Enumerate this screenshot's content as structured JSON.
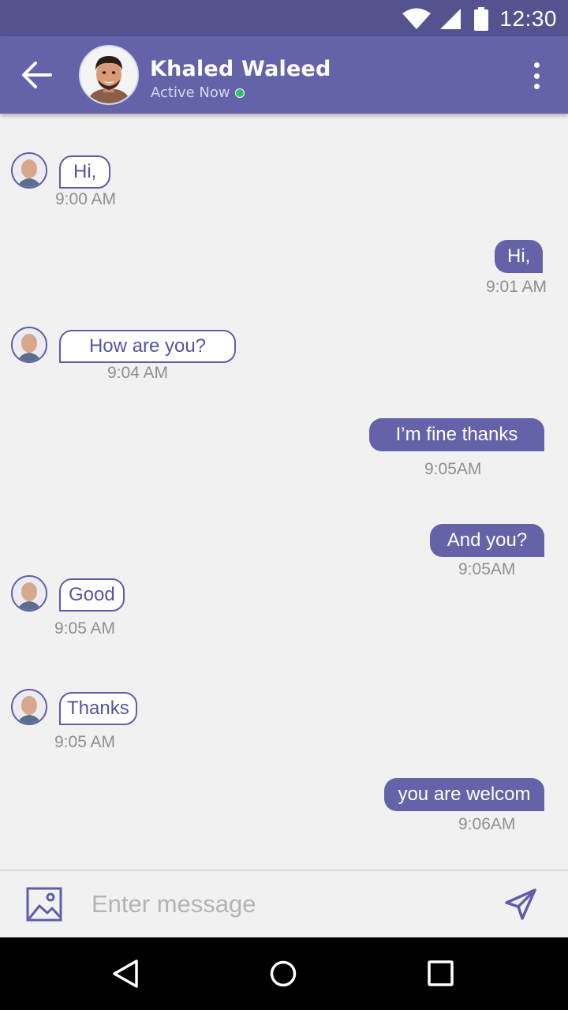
{
  "status_bar": {
    "time": "12:30"
  },
  "header": {
    "contact_name": "Khaled Waleed",
    "status_text": "Active Now",
    "online_color": "#2ebd6e"
  },
  "messages": [
    {
      "direction": "incoming",
      "text": "Hi,",
      "time": "9:00 AM"
    },
    {
      "direction": "outgoing",
      "text": "Hi,",
      "time": "9:01 AM"
    },
    {
      "direction": "incoming",
      "text": "How are you?",
      "time": "9:04 AM"
    },
    {
      "direction": "outgoing",
      "text": "I’m fine thanks",
      "time": "9:05AM"
    },
    {
      "direction": "outgoing",
      "text": "And you?",
      "time": "9:05AM"
    },
    {
      "direction": "incoming",
      "text": "Good",
      "time": "9:05 AM"
    },
    {
      "direction": "incoming",
      "text": "Thanks",
      "time": "9:05 AM"
    },
    {
      "direction": "outgoing",
      "text": "you are welcom",
      "time": "9:06AM"
    }
  ],
  "composer": {
    "placeholder": "Enter message"
  },
  "colors": {
    "primary": "#6463aa",
    "status_bar": "#55538f",
    "background": "#f1f1f1",
    "time_text": "#8f8f8f"
  },
  "icons": {
    "back": "arrow-left-icon",
    "menu": "more-vertical-icon",
    "attach": "image-icon",
    "send": "send-icon",
    "nav_back": "triangle-back-icon",
    "nav_home": "circle-home-icon",
    "nav_recents": "square-recents-icon"
  }
}
